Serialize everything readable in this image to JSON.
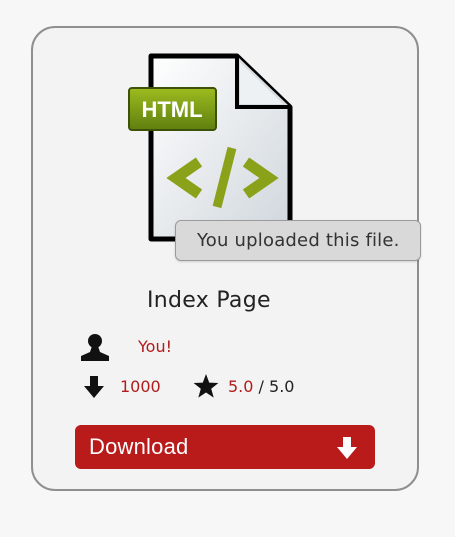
{
  "file": {
    "type_label": "HTML",
    "tooltip": "You uploaded this file.",
    "title": "Index Page"
  },
  "author": {
    "name": "You!",
    "icon": "user-icon"
  },
  "stats": {
    "downloads": "1000",
    "rating_value": "5.0",
    "rating_separator": " / ",
    "rating_max": "5.0",
    "downloads_icon": "arrow-down-icon",
    "rating_icon": "star-icon"
  },
  "actions": {
    "download_label": "Download",
    "download_icon": "arrow-down-icon"
  },
  "colors": {
    "accent": "#b91b1b",
    "link": "#b11c1c",
    "html_badge": "#7a9a16",
    "code_glyph": "#8aa21a"
  }
}
